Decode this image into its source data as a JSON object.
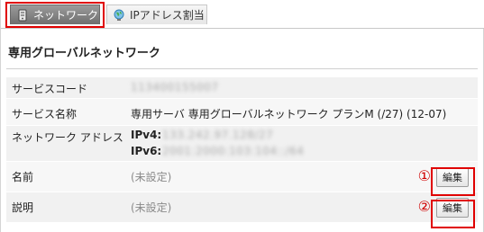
{
  "tabs": [
    {
      "label": "ネットワーク",
      "icon": "server-icon",
      "active": true
    },
    {
      "label": "IPアドレス割当",
      "icon": "globe-icon",
      "active": false
    }
  ],
  "title": "専用グローバルネットワーク",
  "rows": {
    "service_code": {
      "label": "サービスコード",
      "value": "113400155007"
    },
    "service_name": {
      "label": "サービス名称",
      "value": "専用サーバ 専用グローバルネットワーク プランM (/27) (12-07)"
    },
    "network_address": {
      "label": "ネットワーク アドレス",
      "ipv4_label": "IPv4:",
      "ipv4_value": "133.242.97.128/27",
      "ipv6_label": "IPv6:",
      "ipv6_value": "2001:2000:103:104::/64"
    },
    "name": {
      "label": "名前",
      "value": "(未設定)",
      "button": "編集",
      "marker": "①"
    },
    "description": {
      "label": "説明",
      "value": "(未設定)",
      "button": "編集",
      "marker": "②"
    }
  },
  "colors": {
    "highlight": "#e00000",
    "callout": "#d00000",
    "active_tab": "#7a7a7a"
  }
}
